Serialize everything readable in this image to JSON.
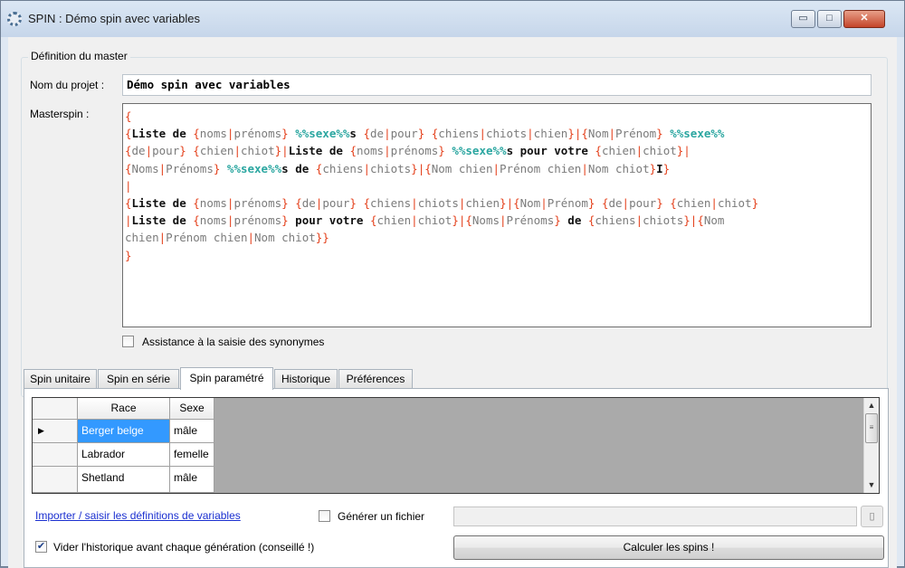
{
  "window": {
    "title": "SPIN : Démo spin avec variables",
    "minimize_glyph": "▭",
    "maximize_glyph": "□",
    "close_glyph": "✕"
  },
  "master_group": {
    "title": "Définition du master",
    "project_label": "Nom du projet :",
    "project_value": "Démo spin avec variables",
    "masterspin_label": "Masterspin :",
    "masterspin_lines": [
      [
        {
          "t": "{",
          "c": "brace"
        }
      ],
      [
        {
          "t": "{",
          "c": "brace"
        },
        {
          "t": "Liste de ",
          "c": "txt"
        },
        {
          "t": "{",
          "c": "brace"
        },
        {
          "t": "noms",
          "c": "opt"
        },
        {
          "t": "|",
          "c": "sep"
        },
        {
          "t": "prénoms",
          "c": "opt"
        },
        {
          "t": "}",
          "c": "brace"
        },
        {
          "t": " ",
          "c": "txt"
        },
        {
          "t": "%%sexe%%",
          "c": "var"
        },
        {
          "t": "s ",
          "c": "txt"
        },
        {
          "t": "{",
          "c": "brace"
        },
        {
          "t": "de",
          "c": "opt"
        },
        {
          "t": "|",
          "c": "sep"
        },
        {
          "t": "pour",
          "c": "opt"
        },
        {
          "t": "}",
          "c": "brace"
        },
        {
          "t": " ",
          "c": "txt"
        },
        {
          "t": "{",
          "c": "brace"
        },
        {
          "t": "chiens",
          "c": "opt"
        },
        {
          "t": "|",
          "c": "sep"
        },
        {
          "t": "chiots",
          "c": "opt"
        },
        {
          "t": "|",
          "c": "sep"
        },
        {
          "t": "chien",
          "c": "opt"
        },
        {
          "t": "}",
          "c": "brace"
        },
        {
          "t": "|",
          "c": "sep"
        },
        {
          "t": "{",
          "c": "brace"
        },
        {
          "t": "Nom",
          "c": "opt"
        },
        {
          "t": "|",
          "c": "sep"
        },
        {
          "t": "Prénom",
          "c": "opt"
        },
        {
          "t": "}",
          "c": "brace"
        },
        {
          "t": " ",
          "c": "txt"
        },
        {
          "t": "%%sexe%%",
          "c": "var"
        }
      ],
      [
        {
          "t": "{",
          "c": "brace"
        },
        {
          "t": "de",
          "c": "opt"
        },
        {
          "t": "|",
          "c": "sep"
        },
        {
          "t": "pour",
          "c": "opt"
        },
        {
          "t": "}",
          "c": "brace"
        },
        {
          "t": " ",
          "c": "txt"
        },
        {
          "t": "{",
          "c": "brace"
        },
        {
          "t": "chien",
          "c": "opt"
        },
        {
          "t": "|",
          "c": "sep"
        },
        {
          "t": "chiot",
          "c": "opt"
        },
        {
          "t": "}",
          "c": "brace"
        },
        {
          "t": "|",
          "c": "sep"
        },
        {
          "t": "Liste de ",
          "c": "txt"
        },
        {
          "t": "{",
          "c": "brace"
        },
        {
          "t": "noms",
          "c": "opt"
        },
        {
          "t": "|",
          "c": "sep"
        },
        {
          "t": "prénoms",
          "c": "opt"
        },
        {
          "t": "}",
          "c": "brace"
        },
        {
          "t": " ",
          "c": "txt"
        },
        {
          "t": "%%sexe%%",
          "c": "var"
        },
        {
          "t": "s pour votre ",
          "c": "txt"
        },
        {
          "t": "{",
          "c": "brace"
        },
        {
          "t": "chien",
          "c": "opt"
        },
        {
          "t": "|",
          "c": "sep"
        },
        {
          "t": "chiot",
          "c": "opt"
        },
        {
          "t": "}",
          "c": "brace"
        },
        {
          "t": "|",
          "c": "sep"
        }
      ],
      [
        {
          "t": "{",
          "c": "brace"
        },
        {
          "t": "Noms",
          "c": "opt"
        },
        {
          "t": "|",
          "c": "sep"
        },
        {
          "t": "Prénoms",
          "c": "opt"
        },
        {
          "t": "}",
          "c": "brace"
        },
        {
          "t": " ",
          "c": "txt"
        },
        {
          "t": "%%sexe%%",
          "c": "var"
        },
        {
          "t": "s de ",
          "c": "txt"
        },
        {
          "t": "{",
          "c": "brace"
        },
        {
          "t": "chiens",
          "c": "opt"
        },
        {
          "t": "|",
          "c": "sep"
        },
        {
          "t": "chiots",
          "c": "opt"
        },
        {
          "t": "}",
          "c": "brace"
        },
        {
          "t": "|",
          "c": "sep"
        },
        {
          "t": "{",
          "c": "brace"
        },
        {
          "t": "Nom chien",
          "c": "opt"
        },
        {
          "t": "|",
          "c": "sep"
        },
        {
          "t": "Prénom chien",
          "c": "opt"
        },
        {
          "t": "|",
          "c": "sep"
        },
        {
          "t": "Nom chiot",
          "c": "opt"
        },
        {
          "t": "}",
          "c": "brace"
        },
        {
          "t": "I",
          "c": "txt"
        },
        {
          "t": "}",
          "c": "brace"
        }
      ],
      [
        {
          "t": "|",
          "c": "sep"
        }
      ],
      [
        {
          "t": "{",
          "c": "brace"
        },
        {
          "t": "Liste de ",
          "c": "txt"
        },
        {
          "t": "{",
          "c": "brace"
        },
        {
          "t": "noms",
          "c": "opt"
        },
        {
          "t": "|",
          "c": "sep"
        },
        {
          "t": "prénoms",
          "c": "opt"
        },
        {
          "t": "}",
          "c": "brace"
        },
        {
          "t": " ",
          "c": "txt"
        },
        {
          "t": "{",
          "c": "brace"
        },
        {
          "t": "de",
          "c": "opt"
        },
        {
          "t": "|",
          "c": "sep"
        },
        {
          "t": "pour",
          "c": "opt"
        },
        {
          "t": "}",
          "c": "brace"
        },
        {
          "t": " ",
          "c": "txt"
        },
        {
          "t": "{",
          "c": "brace"
        },
        {
          "t": "chiens",
          "c": "opt"
        },
        {
          "t": "|",
          "c": "sep"
        },
        {
          "t": "chiots",
          "c": "opt"
        },
        {
          "t": "|",
          "c": "sep"
        },
        {
          "t": "chien",
          "c": "opt"
        },
        {
          "t": "}",
          "c": "brace"
        },
        {
          "t": "|",
          "c": "sep"
        },
        {
          "t": "{",
          "c": "brace"
        },
        {
          "t": "Nom",
          "c": "opt"
        },
        {
          "t": "|",
          "c": "sep"
        },
        {
          "t": "Prénom",
          "c": "opt"
        },
        {
          "t": "}",
          "c": "brace"
        },
        {
          "t": " ",
          "c": "txt"
        },
        {
          "t": "{",
          "c": "brace"
        },
        {
          "t": "de",
          "c": "opt"
        },
        {
          "t": "|",
          "c": "sep"
        },
        {
          "t": "pour",
          "c": "opt"
        },
        {
          "t": "}",
          "c": "brace"
        },
        {
          "t": " ",
          "c": "txt"
        },
        {
          "t": "{",
          "c": "brace"
        },
        {
          "t": "chien",
          "c": "opt"
        },
        {
          "t": "|",
          "c": "sep"
        },
        {
          "t": "chiot",
          "c": "opt"
        },
        {
          "t": "}",
          "c": "brace"
        }
      ],
      [
        {
          "t": "|",
          "c": "sep"
        },
        {
          "t": "Liste de ",
          "c": "txt"
        },
        {
          "t": "{",
          "c": "brace"
        },
        {
          "t": "noms",
          "c": "opt"
        },
        {
          "t": "|",
          "c": "sep"
        },
        {
          "t": "prénoms",
          "c": "opt"
        },
        {
          "t": "}",
          "c": "brace"
        },
        {
          "t": " pour votre ",
          "c": "txt"
        },
        {
          "t": "{",
          "c": "brace"
        },
        {
          "t": "chien",
          "c": "opt"
        },
        {
          "t": "|",
          "c": "sep"
        },
        {
          "t": "chiot",
          "c": "opt"
        },
        {
          "t": "}",
          "c": "brace"
        },
        {
          "t": "|",
          "c": "sep"
        },
        {
          "t": "{",
          "c": "brace"
        },
        {
          "t": "Noms",
          "c": "opt"
        },
        {
          "t": "|",
          "c": "sep"
        },
        {
          "t": "Prénoms",
          "c": "opt"
        },
        {
          "t": "}",
          "c": "brace"
        },
        {
          "t": " de ",
          "c": "txt"
        },
        {
          "t": "{",
          "c": "brace"
        },
        {
          "t": "chiens",
          "c": "opt"
        },
        {
          "t": "|",
          "c": "sep"
        },
        {
          "t": "chiots",
          "c": "opt"
        },
        {
          "t": "}",
          "c": "brace"
        },
        {
          "t": "|",
          "c": "sep"
        },
        {
          "t": "{",
          "c": "brace"
        },
        {
          "t": "Nom",
          "c": "opt"
        }
      ],
      [
        {
          "t": "chien",
          "c": "opt"
        },
        {
          "t": "|",
          "c": "sep"
        },
        {
          "t": "Prénom chien",
          "c": "opt"
        },
        {
          "t": "|",
          "c": "sep"
        },
        {
          "t": "Nom chiot",
          "c": "opt"
        },
        {
          "t": "}}",
          "c": "brace"
        }
      ],
      [
        {
          "t": "}",
          "c": "brace"
        }
      ]
    ],
    "synonyms_checkbox": {
      "label": "Assistance à la saisie des synonymes",
      "checked": false
    }
  },
  "tabs": [
    {
      "label": "Spin unitaire",
      "active": false
    },
    {
      "label": "Spin en série",
      "active": false
    },
    {
      "label": "Spin paramétré",
      "active": true
    },
    {
      "label": "Historique",
      "active": false
    },
    {
      "label": "Préférences",
      "active": false
    }
  ],
  "grid": {
    "columns": [
      "Race",
      "Sexe"
    ],
    "rows": [
      {
        "current": true,
        "cells": [
          "Berger belge",
          "mâle"
        ]
      },
      {
        "current": false,
        "cells": [
          "Labrador",
          "femelle"
        ]
      },
      {
        "current": false,
        "cells": [
          "Shetland",
          "mâle"
        ]
      }
    ],
    "current_row_glyph": "▶",
    "scroll_up_glyph": "▲",
    "scroll_down_glyph": "▼",
    "scroll_thumb_glyph": "≡"
  },
  "bottom": {
    "import_link": "Importer / saisir les définitions de variables",
    "generate_file_label": "Générer un fichier",
    "generate_file_checked": false,
    "file_path": "",
    "browse_glyph": "▯",
    "clear_history_label": "Vider l'historique avant chaque génération (conseillé !)",
    "clear_history_checked": true,
    "calc_button": "Calculer les spins !"
  },
  "colors": {
    "title_bg": "#c6d6ea",
    "brace": "#e4411c",
    "option": "#7b7b7b",
    "variable": "#2aa6a0",
    "selected_cell": "#3399ff",
    "link": "#1a2fd0"
  }
}
